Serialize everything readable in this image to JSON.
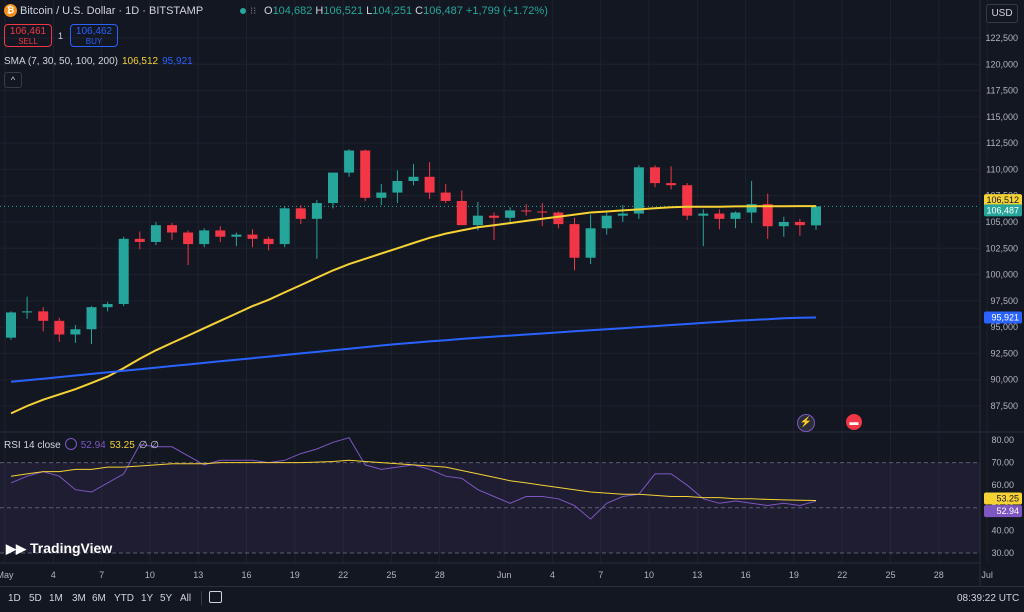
{
  "header": {
    "title": "Bitcoin / U.S. Dollar · 1D · BITSTAMP",
    "ohlc": {
      "o_label": "O",
      "o": "104,682",
      "h_label": "H",
      "h": "106,521",
      "l_label": "L",
      "l": "104,251",
      "c_label": "C",
      "c": "106,487",
      "change": "+1,799 (+1.72%)"
    },
    "sell_price": "106,461",
    "sell_label": "SELL",
    "buy_price": "106,462",
    "buy_label": "BUY",
    "spread": "1",
    "currency": "USD"
  },
  "sma_legend": {
    "label": "SMA (7, 30, 50, 100, 200)",
    "value1": "106,512",
    "value2": "95,921"
  },
  "rsi_legend": {
    "label": "RSI 14 close",
    "value1": "52.94",
    "value2": "53.25",
    "extra": "∅ ∅"
  },
  "branding": "TradingView",
  "ranges": [
    "1D",
    "5D",
    "1M",
    "3M",
    "6M",
    "YTD",
    "1Y",
    "5Y",
    "All"
  ],
  "clock": "08:39:22 UTC",
  "colors": {
    "up": "#26a69a",
    "down": "#f23645",
    "sma_short": "#f6d234",
    "sma_long": "#2962ff",
    "rsi": "#7e57c2",
    "rsi_ma": "#f6d234"
  },
  "chart_data": [
    {
      "type": "candlestick",
      "title": "Bitcoin / U.S. Dollar · 1D · BITSTAMP",
      "ylim": [
        85000,
        125000
      ],
      "y_ticks": [
        "87,500",
        "90,000",
        "92,500",
        "95,000",
        "97,500",
        "100,000",
        "102,500",
        "105,000",
        "107,500",
        "110,000",
        "112,500",
        "115,000",
        "117,500",
        "120,000",
        "122,500"
      ],
      "x_tick_labels": [
        "May",
        "4",
        "7",
        "10",
        "13",
        "16",
        "19",
        "22",
        "25",
        "28",
        "Jun",
        "4",
        "7",
        "10",
        "13",
        "16",
        "19",
        "22",
        "25",
        "28",
        "Jul"
      ],
      "candles": [
        {
          "o": 94000,
          "h": 96500,
          "l": 93800,
          "c": 96400
        },
        {
          "o": 96400,
          "h": 97900,
          "l": 95800,
          "c": 96500
        },
        {
          "o": 96500,
          "h": 96900,
          "l": 94600,
          "c": 95600
        },
        {
          "o": 95600,
          "h": 95900,
          "l": 93600,
          "c": 94300
        },
        {
          "o": 94300,
          "h": 95200,
          "l": 93500,
          "c": 94800
        },
        {
          "o": 94800,
          "h": 97000,
          "l": 93400,
          "c": 96900
        },
        {
          "o": 96900,
          "h": 97400,
          "l": 96500,
          "c": 97200
        },
        {
          "o": 97200,
          "h": 103600,
          "l": 97000,
          "c": 103400
        },
        {
          "o": 103400,
          "h": 104100,
          "l": 102400,
          "c": 103100
        },
        {
          "o": 103100,
          "h": 105000,
          "l": 102800,
          "c": 104700
        },
        {
          "o": 104700,
          "h": 104900,
          "l": 103300,
          "c": 104000
        },
        {
          "o": 104000,
          "h": 104200,
          "l": 100900,
          "c": 102900
        },
        {
          "o": 102900,
          "h": 104400,
          "l": 102600,
          "c": 104200
        },
        {
          "o": 104200,
          "h": 104600,
          "l": 103100,
          "c": 103600
        },
        {
          "o": 103600,
          "h": 104000,
          "l": 102700,
          "c": 103800
        },
        {
          "o": 103800,
          "h": 104300,
          "l": 102600,
          "c": 103400
        },
        {
          "o": 103400,
          "h": 103600,
          "l": 102300,
          "c": 102900
        },
        {
          "o": 102900,
          "h": 106500,
          "l": 102600,
          "c": 106300
        },
        {
          "o": 106300,
          "h": 106600,
          "l": 104800,
          "c": 105300
        },
        {
          "o": 105300,
          "h": 107100,
          "l": 101500,
          "c": 106800
        },
        {
          "o": 106800,
          "h": 109600,
          "l": 106300,
          "c": 109700
        },
        {
          "o": 109700,
          "h": 111900,
          "l": 109300,
          "c": 111800
        },
        {
          "o": 111800,
          "h": 111900,
          "l": 107000,
          "c": 107300
        },
        {
          "o": 107300,
          "h": 108600,
          "l": 106600,
          "c": 107800
        },
        {
          "o": 107800,
          "h": 109900,
          "l": 106800,
          "c": 108900
        },
        {
          "o": 108900,
          "h": 110500,
          "l": 108500,
          "c": 109300
        },
        {
          "o": 109300,
          "h": 110700,
          "l": 107200,
          "c": 107800
        },
        {
          "o": 107800,
          "h": 108600,
          "l": 106800,
          "c": 107000
        },
        {
          "o": 107000,
          "h": 108000,
          "l": 105000,
          "c": 104700
        },
        {
          "o": 104700,
          "h": 106900,
          "l": 104200,
          "c": 105600
        },
        {
          "o": 105600,
          "h": 105900,
          "l": 103300,
          "c": 105400
        },
        {
          "o": 105400,
          "h": 106400,
          "l": 104800,
          "c": 106100
        },
        {
          "o": 106100,
          "h": 106700,
          "l": 105600,
          "c": 106000
        },
        {
          "o": 106000,
          "h": 106800,
          "l": 104600,
          "c": 105900
        },
        {
          "o": 105900,
          "h": 106000,
          "l": 104400,
          "c": 104800
        },
        {
          "o": 104800,
          "h": 105400,
          "l": 100400,
          "c": 101600
        },
        {
          "o": 101600,
          "h": 105700,
          "l": 101000,
          "c": 104400
        },
        {
          "o": 104400,
          "h": 105900,
          "l": 103800,
          "c": 105600
        },
        {
          "o": 105600,
          "h": 106600,
          "l": 105000,
          "c": 105800
        },
        {
          "o": 105800,
          "h": 110400,
          "l": 105300,
          "c": 110200
        },
        {
          "o": 110200,
          "h": 110400,
          "l": 108300,
          "c": 108700
        },
        {
          "o": 108700,
          "h": 110300,
          "l": 108100,
          "c": 108500
        },
        {
          "o": 108500,
          "h": 108700,
          "l": 105200,
          "c": 105600
        },
        {
          "o": 105600,
          "h": 106200,
          "l": 102700,
          "c": 105800
        },
        {
          "o": 105800,
          "h": 106200,
          "l": 104300,
          "c": 105300
        },
        {
          "o": 105300,
          "h": 106000,
          "l": 104400,
          "c": 105900
        },
        {
          "o": 105900,
          "h": 108900,
          "l": 104900,
          "c": 106700
        },
        {
          "o": 106700,
          "h": 107700,
          "l": 103400,
          "c": 104600
        },
        {
          "o": 104600,
          "h": 105500,
          "l": 103600,
          "c": 105000
        },
        {
          "o": 105000,
          "h": 105300,
          "l": 103700,
          "c": 104700
        },
        {
          "o": 104682,
          "h": 106521,
          "l": 104251,
          "c": 106487
        }
      ],
      "sma_short": [
        86800,
        87500,
        88100,
        88600,
        89100,
        89700,
        90300,
        91100,
        92000,
        92800,
        93500,
        94200,
        94900,
        95600,
        96300,
        97000,
        97600,
        98300,
        99000,
        99700,
        100400,
        101000,
        101500,
        102000,
        102500,
        103000,
        103500,
        103900,
        104200,
        104500,
        104700,
        104900,
        105100,
        105300,
        105500,
        105700,
        105900,
        106000,
        106100,
        106200,
        106300,
        106400,
        106450,
        106450,
        106450,
        106480,
        106500,
        106500,
        106500,
        106510,
        106512
      ],
      "sma_long": [
        89800,
        89950,
        90100,
        90250,
        90400,
        90550,
        90700,
        90850,
        91000,
        91150,
        91300,
        91450,
        91600,
        91750,
        91900,
        92050,
        92200,
        92350,
        92500,
        92650,
        92800,
        92950,
        93100,
        93250,
        93400,
        93520,
        93640,
        93760,
        93880,
        94000,
        94100,
        94200,
        94300,
        94400,
        94500,
        94600,
        94700,
        94800,
        94900,
        95000,
        95100,
        95200,
        95300,
        95400,
        95500,
        95600,
        95680,
        95760,
        95840,
        95900,
        95921
      ],
      "last_price": "106,487",
      "sma_short_label": "106,512",
      "sma_long_label": "95,921"
    },
    {
      "type": "line",
      "title": "RSI 14 close",
      "ylim": [
        25,
        85
      ],
      "y_ticks": [
        "30.00",
        "40.00",
        "50.00",
        "60.00",
        "70.00",
        "80.00"
      ],
      "bands": [
        30,
        50,
        70
      ],
      "rsi": [
        61,
        64,
        66,
        64,
        58,
        57,
        61,
        65,
        78,
        77,
        77,
        73,
        69,
        71,
        71,
        71,
        70,
        71,
        74,
        76,
        79,
        81,
        69,
        67,
        68,
        69,
        67,
        64,
        63,
        58,
        55,
        52,
        55,
        55,
        54,
        51,
        45,
        52,
        55,
        56,
        65,
        65,
        60,
        54,
        52,
        53,
        52,
        51,
        52,
        51,
        52.94
      ],
      "rsi_ma": [
        64,
        65,
        66,
        66,
        67,
        67,
        68,
        68,
        68.5,
        69,
        69.5,
        69.5,
        69.5,
        70,
        70,
        70,
        70,
        70,
        70,
        70.2,
        70.5,
        71,
        70.5,
        70,
        69.5,
        69,
        68.5,
        68,
        66.5,
        65,
        63.5,
        62,
        61,
        60,
        59,
        58,
        57,
        56.5,
        56,
        56,
        55.5,
        55,
        55,
        54.5,
        54.5,
        54,
        54,
        53.7,
        53.5,
        53.3,
        53.25
      ],
      "value_label": "52.94",
      "ma_label": "53.25"
    }
  ]
}
